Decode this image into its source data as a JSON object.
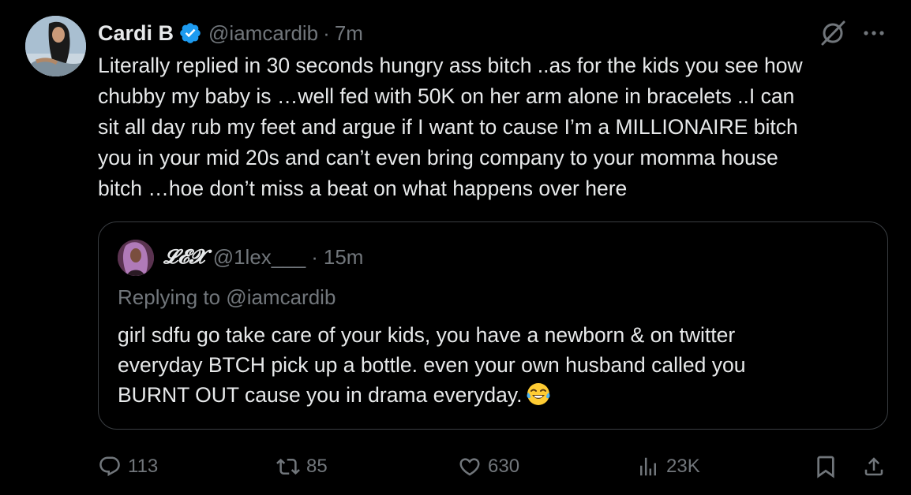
{
  "author": {
    "display_name": "Cardi B",
    "handle": "@iamcardib",
    "dot": "·",
    "time": "7m",
    "avatar_icon": "profile-photo",
    "verified_icon": "verified-badge-icon",
    "verified_color": "#1d9bf0"
  },
  "tweet": {
    "text": "Literally replied in 30 seconds hungry ass bitch ..as for the kids you see how\nchubby my baby is …well fed with 50K on her arm alone in bracelets ..I can\nsit all day rub my feet and argue if I want to cause I’m a MILLIONAIRE bitch\nyou in your mid 20s and can’t even bring company to your momma house\nbitch …hoe don’t miss a beat on what happens over here"
  },
  "quote": {
    "display_name": "𝓛𝓔𝓧",
    "handle": "@1lex___",
    "dot": "·",
    "time": "15m",
    "replying_to": "Replying to @iamcardib",
    "text": "girl sdfu go take care of your kids, you have a newborn & on twitter\neveryday BTCH pick up a bottle. even your own husband called you\nBURNT OUT cause you in drama everyday.",
    "emoji": "face-with-tears-of-joy"
  },
  "actions": {
    "replies": "113",
    "reposts": "85",
    "likes": "630",
    "views": "23K"
  },
  "colors": {
    "background": "#000000",
    "text": "#e7e9ea",
    "muted": "#71767b",
    "border": "#3a3e42"
  }
}
